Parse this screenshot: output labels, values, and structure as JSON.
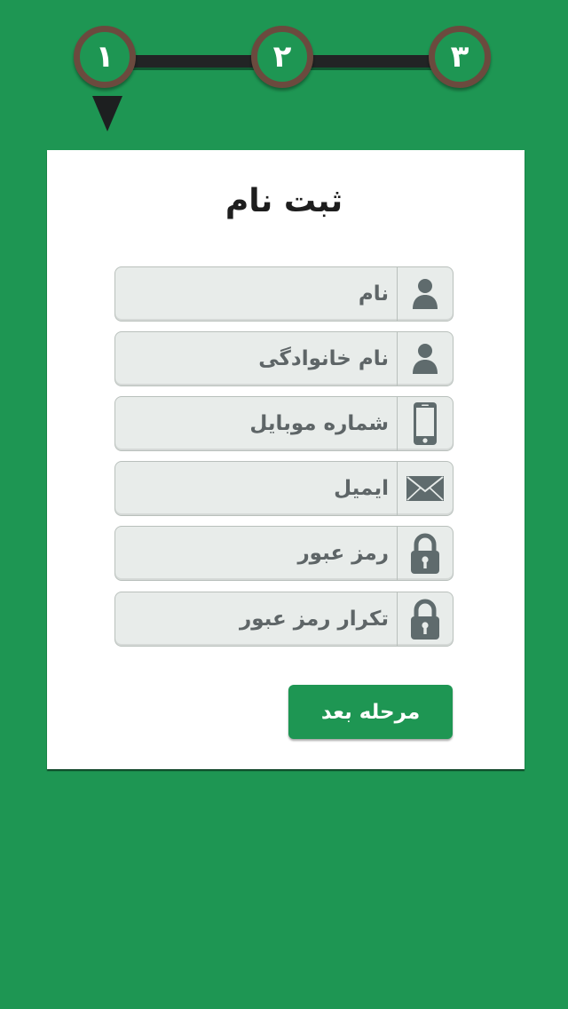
{
  "stepper": {
    "steps": [
      {
        "label": "۱"
      },
      {
        "label": "۲"
      },
      {
        "label": "۳"
      }
    ],
    "active_step": 1
  },
  "form": {
    "title": "ثبت نام",
    "fields": [
      {
        "placeholder": "نام",
        "icon": "user-icon"
      },
      {
        "placeholder": "نام خانوادگی",
        "icon": "user-icon"
      },
      {
        "placeholder": "شماره موبایل",
        "icon": "mobile-phone-icon"
      },
      {
        "placeholder": "ایمیل",
        "icon": "envelope-icon"
      },
      {
        "placeholder": "رمز عبور",
        "icon": "lock-icon"
      },
      {
        "placeholder": "تکرار رمز عبور",
        "icon": "lock-icon"
      }
    ],
    "next_button_label": "مرحله بعد"
  },
  "colors": {
    "background": "#1e9653",
    "card": "#ffffff",
    "step_ring": "#6b4a3e",
    "field_bg": "#e8ecea",
    "icon": "#5f6b6d",
    "button": "#1e9653"
  }
}
